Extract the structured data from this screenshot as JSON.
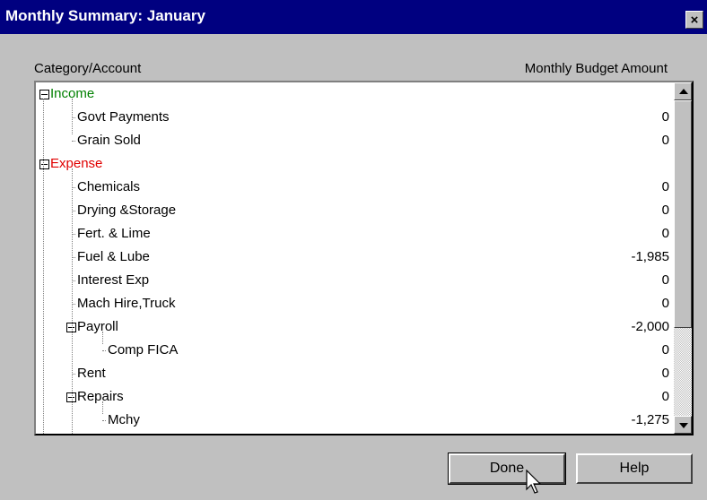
{
  "window": {
    "title": "Monthly Summary: January",
    "close_glyph": "×"
  },
  "columns": {
    "category": "Category/Account",
    "amount": "Monthly Budget Amount"
  },
  "tree": [
    {
      "label": "Income",
      "amount": "",
      "level": 0,
      "type": "category-income",
      "expanded": true
    },
    {
      "label": "Govt Payments",
      "amount": "0",
      "level": 1
    },
    {
      "label": "Grain Sold",
      "amount": "0",
      "level": 1
    },
    {
      "label": "Expense",
      "amount": "",
      "level": 0,
      "type": "category-expense",
      "expanded": true
    },
    {
      "label": "Chemicals",
      "amount": "0",
      "level": 1
    },
    {
      "label": "Drying &Storage",
      "amount": "0",
      "level": 1
    },
    {
      "label": "Fert. & Lime",
      "amount": "0",
      "level": 1
    },
    {
      "label": "Fuel & Lube",
      "amount": "-1,985",
      "level": 1
    },
    {
      "label": "Interest Exp",
      "amount": "0",
      "level": 1
    },
    {
      "label": "Mach Hire,Truck",
      "amount": "0",
      "level": 1
    },
    {
      "label": "Payroll",
      "amount": "-2,000",
      "level": 1,
      "expanded": true
    },
    {
      "label": "Comp FICA",
      "amount": "0",
      "level": 2
    },
    {
      "label": "Rent",
      "amount": "0",
      "level": 1
    },
    {
      "label": "Repairs",
      "amount": "0",
      "level": 1,
      "expanded": true
    },
    {
      "label": "Mchy",
      "amount": "-1,275",
      "level": 2
    }
  ],
  "buttons": {
    "done": "Done",
    "help": "Help"
  },
  "colors": {
    "titlebar": "#000080",
    "income": "#008000",
    "expense": "#e00000",
    "dialog": "#c0c0c0"
  },
  "icons": {
    "close": "close-icon",
    "scroll_up": "scroll-up-arrow-icon",
    "scroll_down": "scroll-down-arrow-icon",
    "cursor": "mouse-pointer-icon"
  }
}
